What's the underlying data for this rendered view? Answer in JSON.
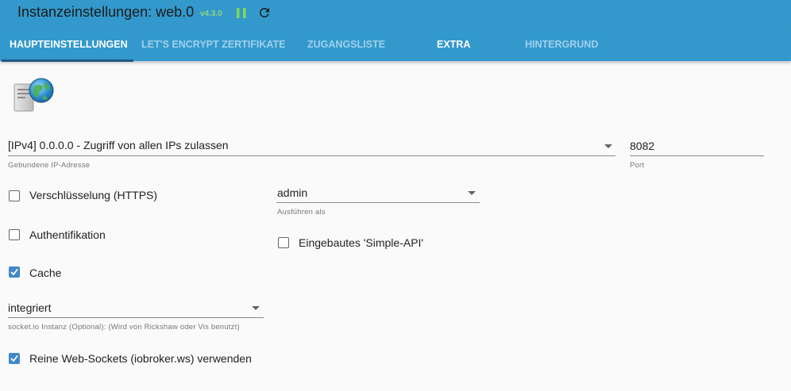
{
  "header": {
    "title": "Instanzeinstellungen: web.0",
    "version": "v4.3.0",
    "colors": {
      "bar": "#3399cc",
      "version": "#8cd87a",
      "pause": "#7ed957"
    }
  },
  "tabs": [
    {
      "label": "HAUPTEINSTELLUNGEN"
    },
    {
      "label": "LET'S ENCRYPT ZERTIFIKATE"
    },
    {
      "label": "ZUGANGSLISTE"
    },
    {
      "label": "EXTRA"
    },
    {
      "label": "HINTERGRUND"
    }
  ],
  "form": {
    "bind": {
      "value": "[IPv4] 0.0.0.0 - Zugriff von allen IPs zulassen",
      "label": "Gebundene IP-Adresse"
    },
    "port": {
      "value": "8082",
      "label": "Port"
    },
    "https": {
      "label": "Verschlüsselung (HTTPS)",
      "checked": false
    },
    "run_as": {
      "value": "admin",
      "label": "Ausführen als"
    },
    "auth": {
      "label": "Authentifikation",
      "checked": false
    },
    "simple_api": {
      "label": "Eingebautes 'Simple-API'",
      "checked": false
    },
    "cache": {
      "label": "Cache",
      "checked": true
    },
    "socketio": {
      "value": "integriert",
      "label": "socket.io Instanz (Optional): (Wird von Rickshaw oder Vis benutzt)"
    },
    "pure_ws": {
      "label": "Reine Web-Sockets (iobroker.ws) verwenden",
      "checked": true
    }
  }
}
